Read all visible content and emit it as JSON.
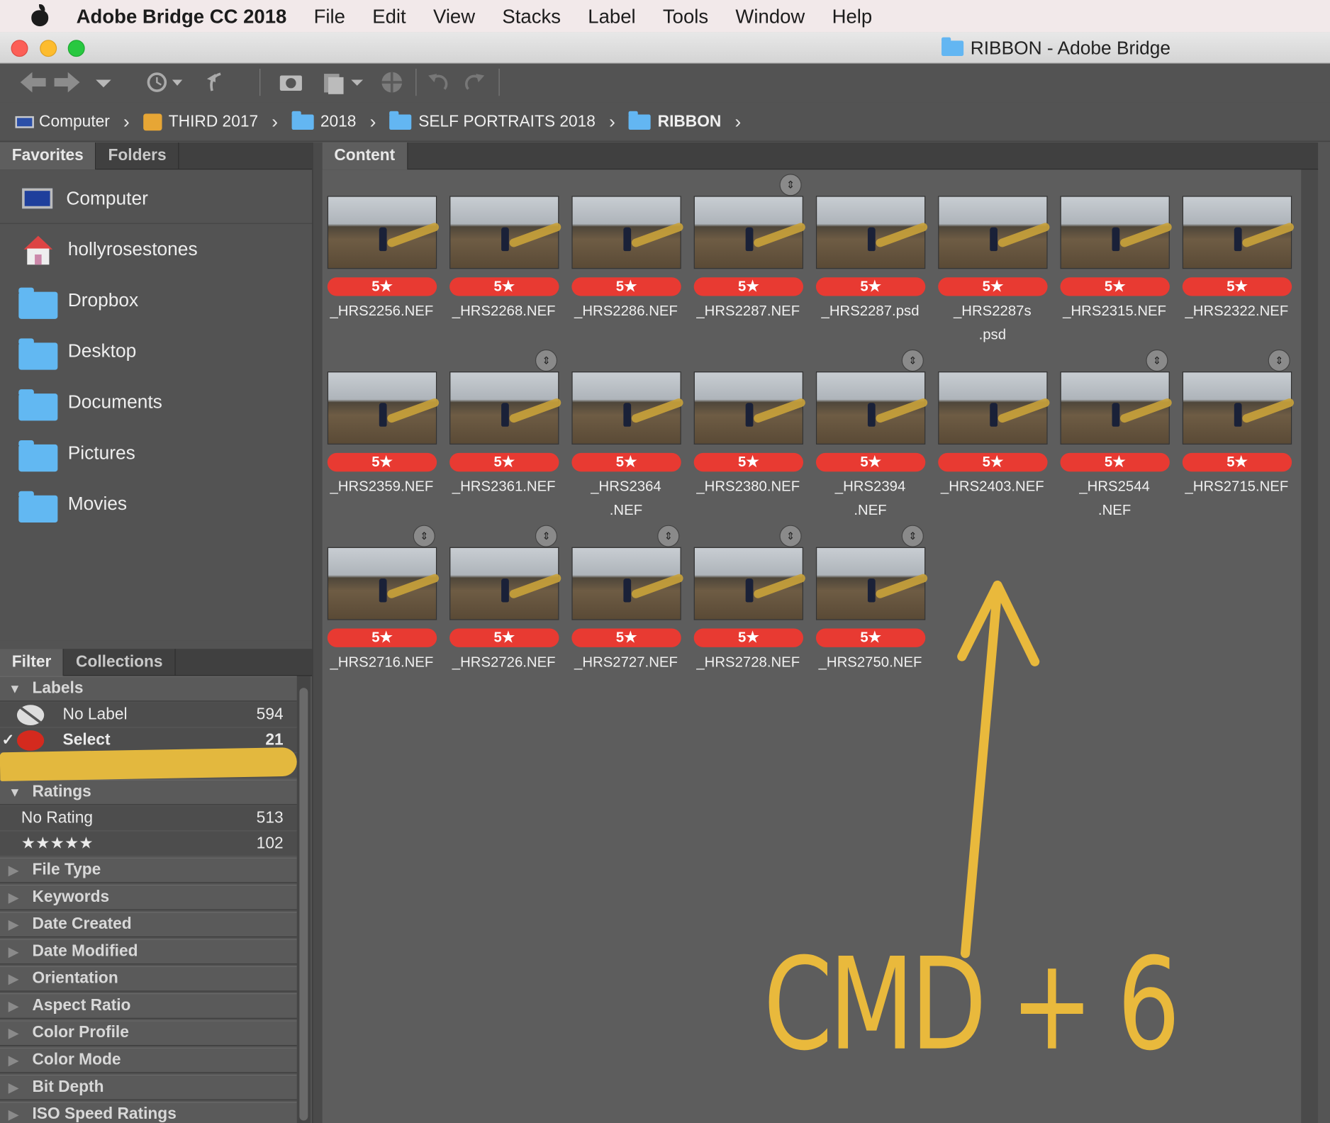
{
  "menubar": {
    "app_name": "Adobe Bridge CC 2018",
    "items": [
      "File",
      "Edit",
      "View",
      "Stacks",
      "Label",
      "Tools",
      "Window",
      "Help"
    ]
  },
  "window": {
    "title": "RIBBON - Adobe Bridge"
  },
  "path": [
    {
      "label": "Computer",
      "icon": "computer-icon"
    },
    {
      "label": "THIRD 2017",
      "icon": "drive-icon"
    },
    {
      "label": "2018",
      "icon": "folder-icon"
    },
    {
      "label": "SELF PORTRAITS 2018",
      "icon": "folder-icon"
    },
    {
      "label": "RIBBON",
      "icon": "folder-icon"
    }
  ],
  "left_tabs": {
    "favorites": "Favorites",
    "folders": "Folders"
  },
  "favorites": [
    "Computer",
    "hollyrosestones",
    "Dropbox",
    "Desktop",
    "Documents",
    "Pictures",
    "Movies"
  ],
  "filter_tabs": {
    "filter": "Filter",
    "collections": "Collections"
  },
  "filter": {
    "labels_header": "Labels",
    "no_label": "No Label",
    "no_label_count": "594",
    "select": "Select",
    "select_count": "21",
    "ratings_header": "Ratings",
    "no_rating": "No Rating",
    "no_rating_count": "513",
    "five_stars": "★★★★★",
    "five_stars_count": "102",
    "sections": [
      "File Type",
      "Keywords",
      "Date Created",
      "Date Modified",
      "Orientation",
      "Aspect Ratio",
      "Color Profile",
      "Color Mode",
      "Bit Depth",
      "ISO Speed Ratings"
    ]
  },
  "content_tab": "Content",
  "rating_badge": "5★",
  "thumbnails": [
    {
      "name": "_HRS2256.NEF",
      "stacked": false
    },
    {
      "name": "_HRS2268.NEF",
      "stacked": false
    },
    {
      "name": "_HRS2286.NEF",
      "stacked": false
    },
    {
      "name": "_HRS2287.NEF",
      "stacked": true
    },
    {
      "name": "_HRS2287.psd",
      "stacked": false
    },
    {
      "name": "_HRS2287s\n.psd",
      "stacked": false
    },
    {
      "name": "_HRS2315.NEF",
      "stacked": false
    },
    {
      "name": "_HRS2322.NEF",
      "stacked": false
    },
    {
      "name": "_HRS2359.NEF",
      "stacked": false
    },
    {
      "name": "_HRS2361.NEF",
      "stacked": true
    },
    {
      "name": "_HRS2364\n.NEF",
      "stacked": false
    },
    {
      "name": "_HRS2380.NEF",
      "stacked": false
    },
    {
      "name": "_HRS2394\n.NEF",
      "stacked": true
    },
    {
      "name": "_HRS2403.NEF",
      "stacked": false
    },
    {
      "name": "_HRS2544\n.NEF",
      "stacked": true
    },
    {
      "name": "_HRS2715.NEF",
      "stacked": true
    },
    {
      "name": "_HRS2716.NEF",
      "stacked": true
    },
    {
      "name": "_HRS2726.NEF",
      "stacked": true
    },
    {
      "name": "_HRS2727.NEF",
      "stacked": true
    },
    {
      "name": "_HRS2728.NEF",
      "stacked": true
    },
    {
      "name": "_HRS2750.NEF",
      "stacked": true
    }
  ],
  "annotation": {
    "text": "CMD + 6",
    "color": "#e9b93c"
  },
  "colors": {
    "badge": "#e83a32",
    "panel": "#535353",
    "content": "#5d5d5d"
  }
}
